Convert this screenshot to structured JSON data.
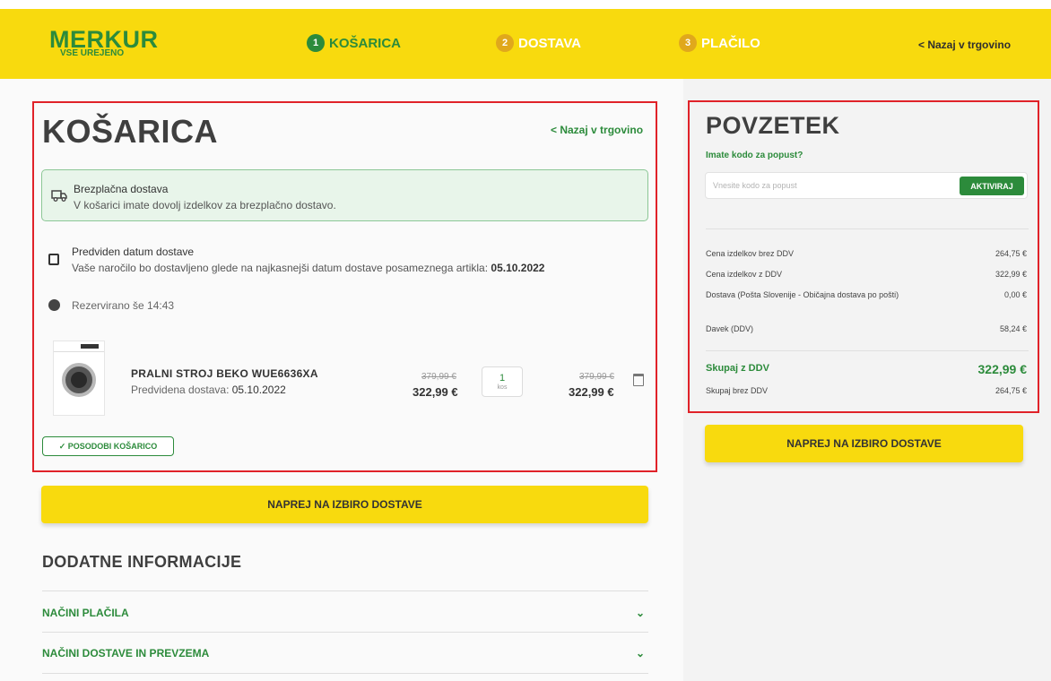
{
  "header": {
    "logo_main": "MERKUR",
    "logo_sub": "VSE UREJENO",
    "steps": [
      {
        "num": "1",
        "label": "KOŠARICA"
      },
      {
        "num": "2",
        "label": "DOSTAVA"
      },
      {
        "num": "3",
        "label": "PLAČILO"
      }
    ],
    "back_link": "< Nazaj v trgovino"
  },
  "cart": {
    "title": "KOŠARICA",
    "back_link": "< Nazaj v trgovino",
    "free_delivery": {
      "title": "Brezplačna dostava",
      "text": "V košarici imate dovolj izdelkov za brezplačno dostavo."
    },
    "delivery_date": {
      "title": "Predviden datum dostave",
      "text": "Vaše naročilo bo dostavljeno glede na najkasnejši datum dostave posameznega artikla: ",
      "date": "05.10.2022"
    },
    "reserved": "Rezervirano še 14:43",
    "item": {
      "name": "PRALNI STROJ BEKO WUE6636XA",
      "delivery_label": "Predvidena dostava: ",
      "delivery_date": "05.10.2022",
      "unit_old_price": "379,99 €",
      "unit_price": "322,99 €",
      "quantity": "1",
      "quantity_unit": "kos",
      "total_old_price": "379,99 €",
      "total_price": "322,99 €"
    },
    "update_button": "✓ POSODOBI KOŠARICO",
    "cta": "NAPREJ NA IZBIRO DOSTAVE"
  },
  "additional": {
    "title": "DODATNE INFORMACIJE",
    "items": [
      {
        "label": "NAČINI PLAČILA"
      },
      {
        "label": "NAČINI DOSTAVE IN PREVZEMA"
      }
    ]
  },
  "summary": {
    "title": "POVZETEK",
    "promo_label": "Imate kodo za popust?",
    "promo_placeholder": "Vnesite kodo za popust",
    "promo_button": "AKTIVIRAJ",
    "rows": [
      {
        "label": "Cena izdelkov brez DDV",
        "value": "264,75 €"
      },
      {
        "label": "Cena izdelkov z DDV",
        "value": "322,99 €"
      },
      {
        "label": "Dostava (Pošta Slovenije - Običajna dostava po pošti)",
        "value": "0,00 €"
      },
      {
        "label": "Davek (DDV)",
        "value": "58,24 €"
      }
    ],
    "total_label": "Skupaj z DDV",
    "total_value": "322,99 €",
    "total_net_label": "Skupaj brez DDV",
    "total_net_value": "264,75 €",
    "cta": "NAPREJ NA IZBIRO DOSTAVE"
  },
  "colors": {
    "brand_yellow": "#f8da0e",
    "brand_green": "#2c8b3b",
    "highlight_red": "#e02229"
  }
}
